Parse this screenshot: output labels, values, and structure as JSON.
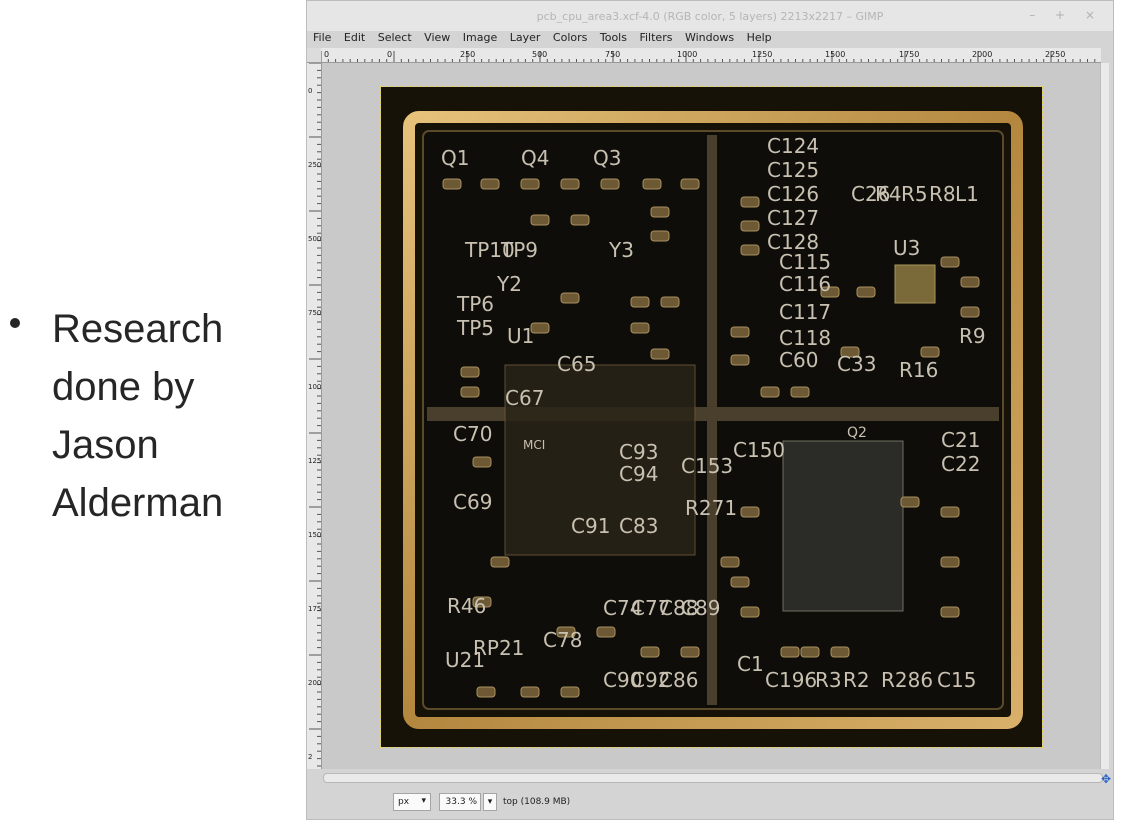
{
  "slide": {
    "bullet_text": "Research done by Jason Alderman"
  },
  "window": {
    "title": "pcb_cpu_area3.xcf-4.0 (RGB color, 5 layers) 2213x2217 – GIMP",
    "controls": [
      "–",
      "+",
      "×"
    ]
  },
  "menu": [
    "File",
    "Edit",
    "Select",
    "View",
    "Image",
    "Layer",
    "Colors",
    "Tools",
    "Filters",
    "Windows",
    "Help"
  ],
  "ruler": {
    "h_ticks": [
      "0",
      "0",
      "250",
      "500",
      "750",
      "1000",
      "1250",
      "1500",
      "1750",
      "2000",
      "2250"
    ],
    "v_ticks": [
      "0",
      "250",
      "500",
      "750",
      "1000",
      "1250",
      "1500",
      "1750",
      "2000",
      "2"
    ]
  },
  "status": {
    "unit": "px",
    "zoom": "33.3 %",
    "message": "top (108.9 MB)"
  },
  "silkscreen": {
    "labels": [
      "Q1",
      "Q4",
      "Q3",
      "C124",
      "C125",
      "C126",
      "C127",
      "C128",
      "C26",
      "R4",
      "R5",
      "R8",
      "L1",
      "TP10",
      "TP9",
      "Y3",
      "Y2",
      "U3",
      "TP6",
      "TP5",
      "U1",
      "C115",
      "C116",
      "C117",
      "C118",
      "C60",
      "C33",
      "R16",
      "R9",
      "C65",
      "C67",
      "C70",
      "C69",
      "C93",
      "C94",
      "C91",
      "C83",
      "C153",
      "C150",
      "R271",
      "R46",
      "U21",
      "RP21",
      "C78",
      "C90",
      "C92",
      "C86",
      "C74",
      "C77",
      "C88",
      "C89",
      "C1",
      "C196",
      "R3",
      "R2",
      "R286",
      "C15",
      "C21",
      "C22",
      "MCI",
      "Q2"
    ]
  },
  "colors": {
    "board": "#171208",
    "gold": "#c8a35a",
    "silk": "#c8c0b0",
    "window_bg": "#d4d4d4",
    "accent": "#2a62c9"
  }
}
